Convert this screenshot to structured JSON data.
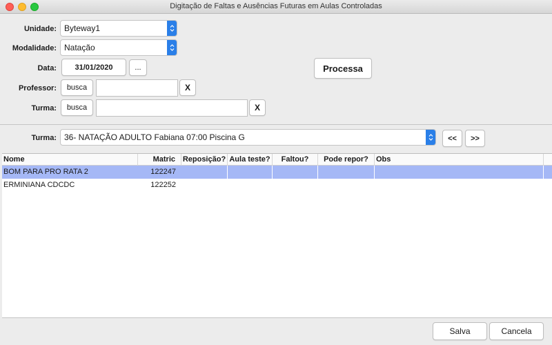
{
  "window": {
    "title": "Digitação de Faltas e Ausências Futuras em Aulas Controladas"
  },
  "form": {
    "unidade_label": "Unidade:",
    "unidade_value": "Byteway1",
    "modalidade_label": "Modalidade:",
    "modalidade_value": "Natação",
    "data_label": "Data:",
    "data_value": "31/01/2020",
    "data_picker": "...",
    "professor_label": "Professor:",
    "professor_busca": "busca",
    "professor_value": "",
    "professor_clear": "X",
    "turma_label": "Turma:",
    "turma_busca": "busca",
    "turma_value": "",
    "turma_clear": "X",
    "processa": "Processa"
  },
  "selector": {
    "turma_label": "Turma:",
    "turma_value": "36- NATAÇÃO ADULTO Fabiana 07:00  Piscina G",
    "prev": "<<",
    "next": ">>"
  },
  "table": {
    "columns": [
      "Nome",
      "Matric",
      "Reposição?",
      "Aula teste?",
      "Faltou?",
      "Pode repor?",
      "Obs"
    ],
    "rows": [
      {
        "nome": "BOM PARA PRO RATA 2",
        "matric": "122247",
        "selected": true
      },
      {
        "nome": "ERMINIANA CDCDC",
        "matric": "122252",
        "selected": false
      }
    ]
  },
  "footer": {
    "salva": "Salva",
    "cancela": "Cancela"
  },
  "colors": {
    "accent": "#2a7fe8",
    "selection": "#a5b8f6"
  }
}
